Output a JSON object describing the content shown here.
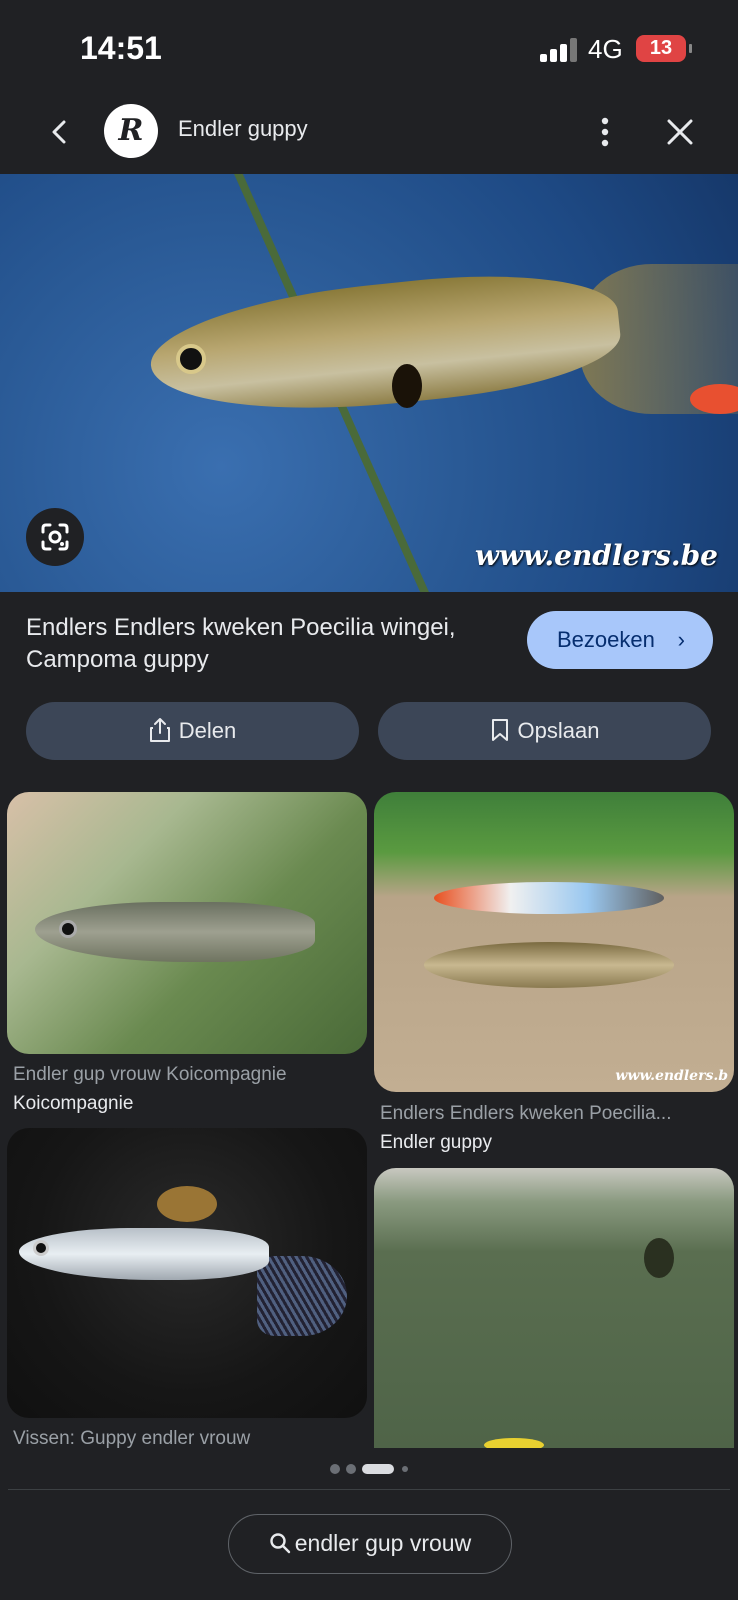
{
  "status_bar": {
    "time": "14:51",
    "network": "4G",
    "battery": "13"
  },
  "header": {
    "favicon_letter": "R",
    "title": "Endler guppy",
    "icons": [
      "back-arrow-icon",
      "more-vert-icon",
      "close-icon"
    ]
  },
  "hero": {
    "watermark": "www.endlers.be",
    "lens_icon": "google-lens-icon"
  },
  "result": {
    "title": "Endlers Endlers kweken Poecilia wingei, Campoma guppy",
    "visit_label": "Bezoeken",
    "share_label": "Delen",
    "save_label": "Opslaan"
  },
  "related": [
    {
      "caption": "Endler gup vrouw Koicompagnie",
      "source": "Koicompagnie"
    },
    {
      "caption": "Endlers Endlers kweken Poecilia...",
      "source": "Endler guppy",
      "watermark": "www.endlers.b"
    },
    {
      "caption": "Vissen: Guppy endler vrouw",
      "source": ""
    },
    {
      "caption": "",
      "source": ""
    }
  ],
  "pager": {
    "count": 4,
    "active": 2
  },
  "search": {
    "query": "endler gup vrouw"
  },
  "colors": {
    "background": "#202124",
    "visit_button": "#a8c7fa",
    "action_button": "#3c4657",
    "battery_low": "#e04444"
  }
}
